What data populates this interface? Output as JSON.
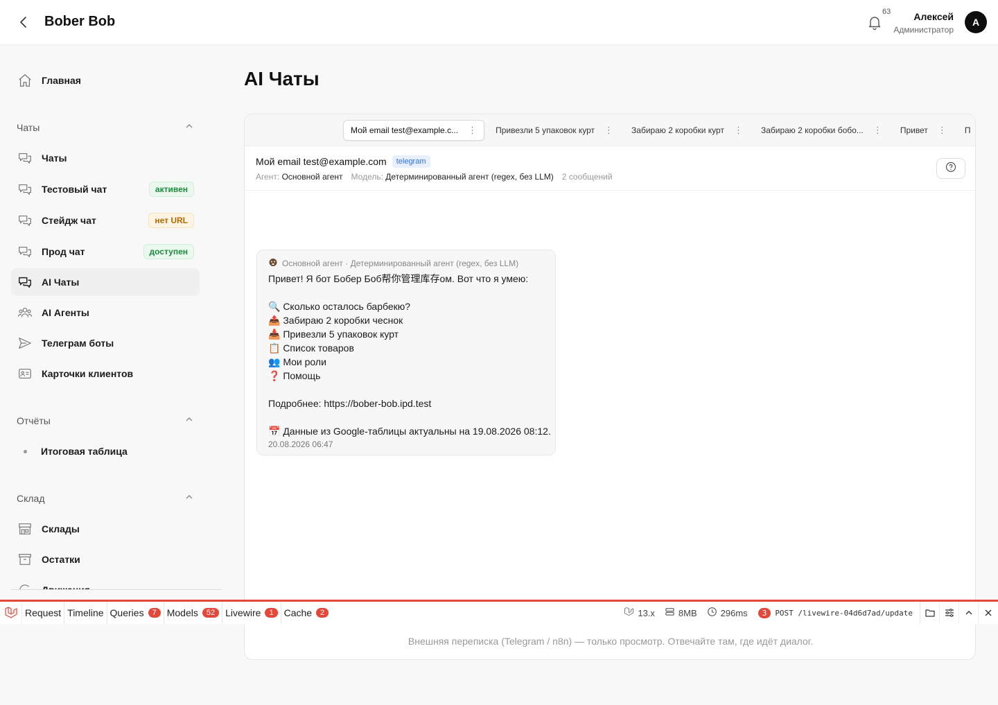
{
  "header": {
    "title": "Bober Bob",
    "notifications_count": "63",
    "user_name": "Алексей",
    "user_role": "Администратор",
    "avatar_letter": "A"
  },
  "sidebar": {
    "home": "Главная",
    "sections": {
      "chats": "Чаты",
      "reports": "Отчёты",
      "warehouse": "Склад"
    },
    "items": [
      {
        "label": "Чаты"
      },
      {
        "label": "Тестовый чат",
        "badge": "активен",
        "badge_color": "#1c8b3e"
      },
      {
        "label": "Стейдж чат",
        "badge": "нет URL",
        "badge_color": "#b26a00"
      },
      {
        "label": "Прод чат",
        "badge": "доступен",
        "badge_color": "#1c8b3e"
      },
      {
        "label": "AI Чаты"
      },
      {
        "label": "AI Агенты"
      },
      {
        "label": "Телеграм боты"
      },
      {
        "label": "Карточки клиентов"
      },
      {
        "label": "Итоговая таблица"
      },
      {
        "label": "Склады"
      },
      {
        "label": "Остатки"
      },
      {
        "label": "Движения"
      }
    ]
  },
  "main": {
    "title": "AI Чаты",
    "tabs": [
      "Мой email test@example.c...",
      "Привезли 5 упаковок курт",
      "Забираю 2 коробки курт",
      "Забираю 2 коробки бобо...",
      "Привет",
      "П"
    ],
    "chat": {
      "title": "Мой email test@example.com",
      "channel": "telegram",
      "agent_label": "Агент:",
      "agent": "Основной агент",
      "model_label": "Модель:",
      "model": "Детерминированный агент (regex, без LLM)",
      "messages": "2 сообщений"
    },
    "message": {
      "meta": "Основной агент · Детерминированный агент (regex, без LLM)",
      "lines": [
        "Привет! Я бот Бобер Боб帮你管理库存ом. Вот что я умею:",
        "",
        "🔍 Сколько осталось барбекю?",
        "📤 Забираю 2 коробки чеснок",
        "📥 Привезли 5 упаковок курт",
        "📋 Список товаров",
        "👥 Мои роли",
        "❓ Помощь",
        "",
        "Подробнее: https://bober-bob.ipd.test",
        "",
        "📅 Данные из Google-таблицы актуальны на 19.08.2026 08:12."
      ],
      "time": "20.08.2026 06:47"
    },
    "footer_note": "Внешняя переписка (Telegram / n8n) — только просмотр. Отвечайте там, где идёт диалог."
  },
  "debugbar": {
    "tabs": [
      {
        "label": "Request"
      },
      {
        "label": "Timeline"
      },
      {
        "label": "Queries",
        "count": "7"
      },
      {
        "label": "Models",
        "count": "52"
      },
      {
        "label": "Livewire",
        "count": "1"
      },
      {
        "label": "Cache",
        "count": "2"
      }
    ],
    "version": "13.x",
    "memory": "8MB",
    "duration": "296ms",
    "req_count": "3",
    "request": "POST /livewire-04d6d7ad/update",
    "accent": "#e3483a"
  }
}
